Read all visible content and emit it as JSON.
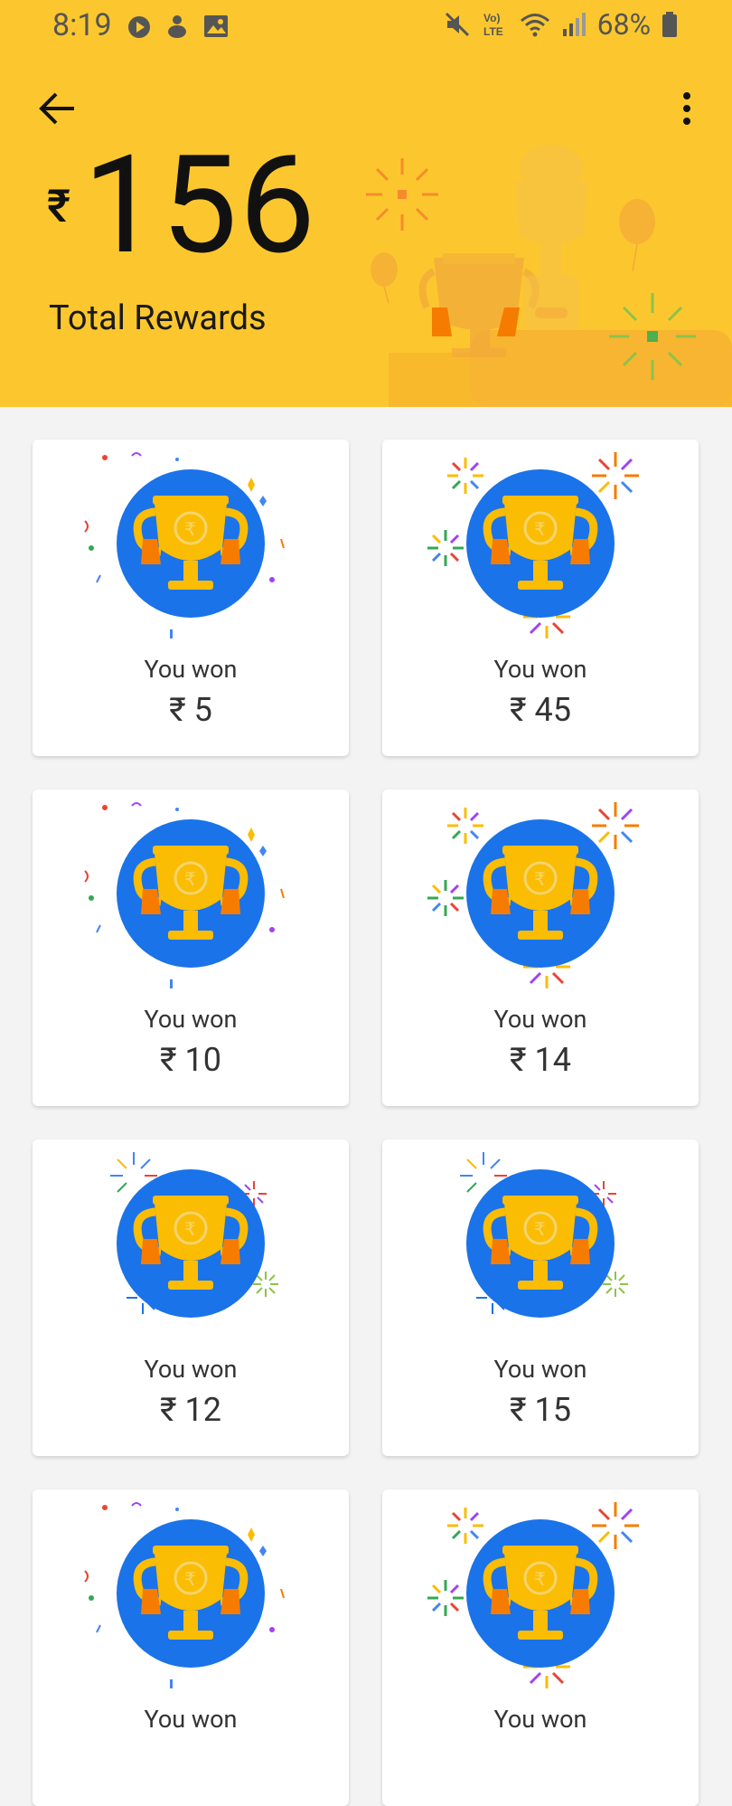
{
  "status_bar": {
    "time": "8:19",
    "battery": "68%"
  },
  "header": {
    "currency_symbol": "₹",
    "total_amount": "156",
    "total_label": "Total Rewards",
    "background_color": "#fcc72e"
  },
  "rewards": [
    {
      "label": "You won",
      "amount": "₹ 5",
      "style": "confetti"
    },
    {
      "label": "You won",
      "amount": "₹ 45",
      "style": "fireworks"
    },
    {
      "label": "You won",
      "amount": "₹ 10",
      "style": "confetti"
    },
    {
      "label": "You won",
      "amount": "₹ 14",
      "style": "fireworks"
    },
    {
      "label": "You won",
      "amount": "₹ 12",
      "style": "sparks"
    },
    {
      "label": "You won",
      "amount": "₹ 15",
      "style": "sparks"
    },
    {
      "label": "You won",
      "amount": "",
      "style": "confetti"
    },
    {
      "label": "You won",
      "amount": "",
      "style": "fireworks"
    }
  ],
  "colors": {
    "trophy_circle": "#1a73e8",
    "trophy_gold": "#fbbc04",
    "ribbon": "#f57c00"
  }
}
